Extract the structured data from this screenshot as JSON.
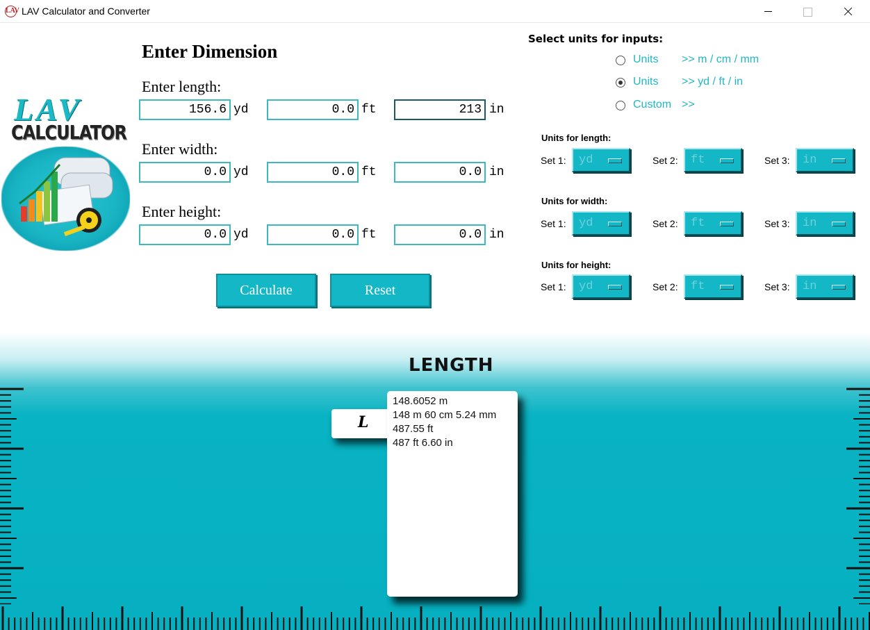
{
  "window": {
    "title": "LAV Calculator and Converter"
  },
  "logo": {
    "line1": "LAV",
    "line2": "CALCULATOR"
  },
  "heading": "Enter Dimension",
  "dimensions": {
    "length": {
      "label": "Enter length:",
      "yd": "156.6",
      "ft": "0.0",
      "in": "213"
    },
    "width": {
      "label": "Enter width:",
      "yd": "0.0",
      "ft": "0.0",
      "in": "0.0"
    },
    "height": {
      "label": "Enter height:",
      "yd": "0.0",
      "ft": "0.0",
      "in": "0.0"
    }
  },
  "unit_labels": {
    "yd": "yd",
    "ft": "ft",
    "in": "in"
  },
  "buttons": {
    "calculate": "Calculate",
    "reset": "Reset"
  },
  "unit_select": {
    "title": "Select units for inputs:",
    "options": [
      {
        "name": "Units",
        "desc": ">> m / cm / mm",
        "checked": false
      },
      {
        "name": "Units",
        "desc": ">> yd / ft / in",
        "checked": true
      },
      {
        "name": "Custom",
        "desc": ">>",
        "checked": false
      }
    ]
  },
  "unit_groups": [
    {
      "title": "Units for length:",
      "sets": [
        {
          "label": "Set 1:",
          "value": "yd"
        },
        {
          "label": "Set 2:",
          "value": "ft"
        },
        {
          "label": "Set 3:",
          "value": "in"
        }
      ]
    },
    {
      "title": "Units for width:",
      "sets": [
        {
          "label": "Set 1:",
          "value": "yd"
        },
        {
          "label": "Set 2:",
          "value": "ft"
        },
        {
          "label": "Set 3:",
          "value": "in"
        }
      ]
    },
    {
      "title": "Units for height:",
      "sets": [
        {
          "label": "Set 1:",
          "value": "yd"
        },
        {
          "label": "Set 2:",
          "value": "ft"
        },
        {
          "label": "Set 3:",
          "value": "in"
        }
      ]
    }
  ],
  "result": {
    "title": "LENGTH",
    "tag": "L",
    "lines": [
      "148.6052 m",
      "148 m  60 cm  5.24 mm",
      "487.55 ft",
      "487 ft  6.60 in"
    ]
  },
  "colors": {
    "accent": "#14b7c6",
    "accent_text": "#22b6c4",
    "field_border": "#3bb8c4"
  }
}
